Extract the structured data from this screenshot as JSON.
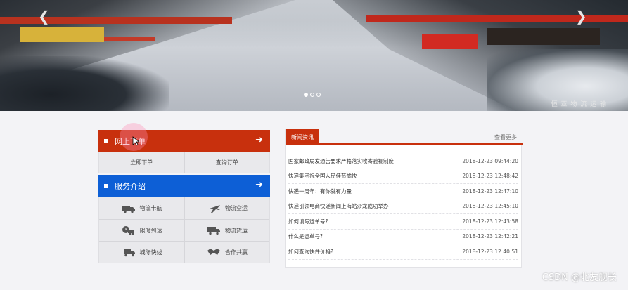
{
  "banner": {
    "caption": "恒 亚 物 流 运 输",
    "prev_icon": "chevron-left-icon",
    "next_icon": "chevron-right-icon",
    "dots": [
      true,
      false,
      false
    ]
  },
  "order": {
    "title": "网上下单",
    "actions": [
      "立即下单",
      "查询订单"
    ],
    "accent": "#c8300d"
  },
  "services": {
    "title": "服务介绍",
    "accent": "#0d5fd6",
    "items": [
      {
        "label": "物流卡航",
        "icon": "truck-icon"
      },
      {
        "label": "物流空运",
        "icon": "airplane-icon"
      },
      {
        "label": "限时到达",
        "icon": "clock-truck-icon"
      },
      {
        "label": "物流货运",
        "icon": "cargo-truck-icon"
      },
      {
        "label": "城际快线",
        "icon": "fast-truck-icon"
      },
      {
        "label": "合作共赢",
        "icon": "handshake-icon"
      }
    ]
  },
  "news": {
    "tab": "新闻资讯",
    "more": "查看更多",
    "items": [
      {
        "title": "国家邮政局发通告要求严格落实收寄验视制度",
        "date": "2018-12-23 09:44:20"
      },
      {
        "title": "快递集团祝全国人民佳节愉快",
        "date": "2018-12-23 12:48:42"
      },
      {
        "title": "快递一周年：有你就有力量",
        "date": "2018-12-23 12:47:10"
      },
      {
        "title": "快递引领电商快递新闻上海站沙龙成功举办",
        "date": "2018-12-23 12:45:10"
      },
      {
        "title": "如何填写运单号?",
        "date": "2018-12-23 12:43:58"
      },
      {
        "title": "什么是运单号?",
        "date": "2018-12-23 12:42:21"
      },
      {
        "title": "如何查询快件价格?",
        "date": "2018-12-23 12:40:51"
      }
    ]
  },
  "watermark": "CSDN @北友舰长"
}
